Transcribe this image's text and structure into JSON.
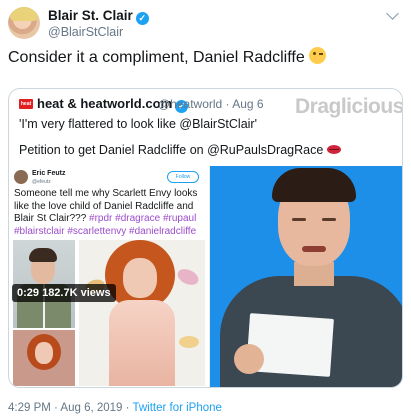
{
  "author": {
    "name": "Blair St. Clair",
    "handle": "@BlairStClair",
    "verified_glyph": "✓"
  },
  "tweet": {
    "text": "Consider it a compliment, Daniel Radcliffe",
    "emoji": "winking-face"
  },
  "quote": {
    "logo_text": "heat",
    "name": "heat & heatworld.com",
    "handle_date": "@heatworld · Aug 6",
    "line1": "'I'm very flattered to look like @BlairStClair'",
    "line2": "Petition to get Daniel Radcliffe on @RuPaulsDragRace",
    "watermark": "Draglicious"
  },
  "embedded_tweet": {
    "name": "Eric Feutz",
    "handle": "@efeutz",
    "follow_label": "Follow",
    "text_plain": "Someone tell me why Scarlett Envy looks like the love child of Daniel Radcliffe and Blair St Clair??? ",
    "text_tags": "#rpdr #dragrace #rupaul #blairstclair #scarlettenvy #danielradcliffe"
  },
  "video": {
    "badge": "0:29  182.7K views"
  },
  "footer": {
    "time": "4:29 PM · Aug 6, 2019 · ",
    "source": "Twitter for iPhone"
  }
}
